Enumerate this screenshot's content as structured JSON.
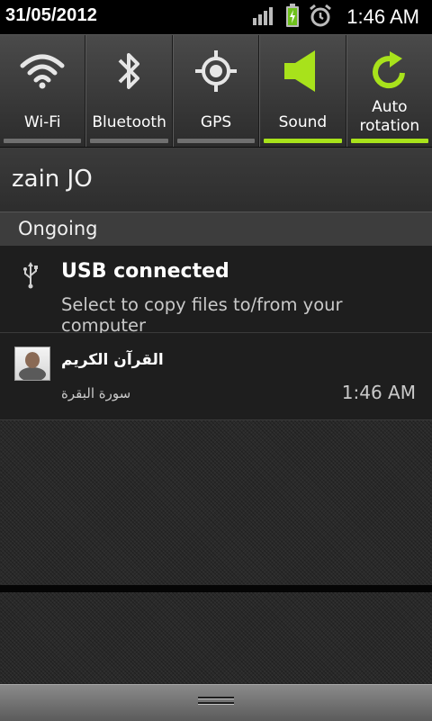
{
  "status_bar": {
    "date": "31/05/2012",
    "time": "1:46 AM",
    "icons": [
      "signal-icon",
      "battery-charging-icon",
      "alarm-icon"
    ]
  },
  "quick_settings": [
    {
      "label": "Wi-Fi",
      "icon": "wifi-icon",
      "enabled": false
    },
    {
      "label": "Bluetooth",
      "icon": "bluetooth-icon",
      "enabled": false
    },
    {
      "label": "GPS",
      "icon": "gps-icon",
      "enabled": false
    },
    {
      "label": "Sound",
      "icon": "sound-icon",
      "enabled": true
    },
    {
      "label_line1": "Auto",
      "label_line2": "rotation",
      "icon": "auto-rotation-icon",
      "enabled": true
    }
  ],
  "carrier": "zain JO",
  "section": {
    "title": "Ongoing"
  },
  "notifications": {
    "usb": {
      "title": "USB connected",
      "description": "Select to copy files to/from your computer",
      "icon": "usb-icon"
    },
    "quran": {
      "title": "القرآن الكريم",
      "subtitle": "سورة البقرة",
      "time": "1:46 AM"
    }
  },
  "colors": {
    "accent_on": "#a8e21b",
    "bar_off": "#6f6f6f",
    "background": "#1b1b1b"
  }
}
